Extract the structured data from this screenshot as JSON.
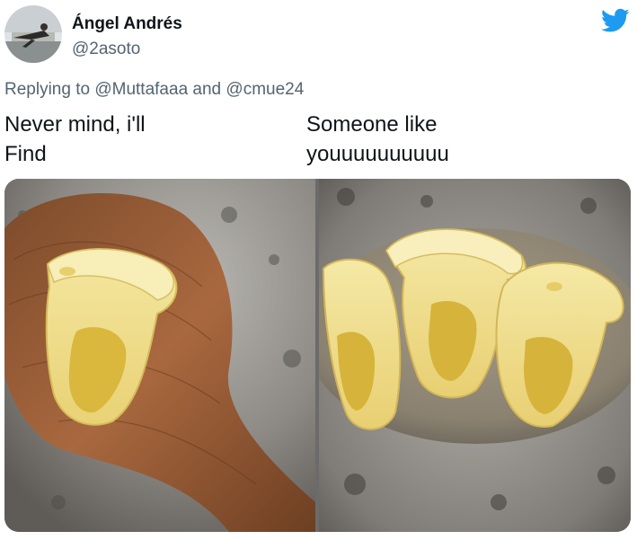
{
  "author": {
    "display_name": "Ángel Andrés",
    "handle": "@2asoto"
  },
  "reply": {
    "prefix": "Replying to",
    "mention_1": "@Muttafaaa",
    "conjunction": "and",
    "mention_2": "@cmue24"
  },
  "tweet": {
    "left_line_1": "Never mind, i'll",
    "left_line_2": "Find",
    "right_line_1": "Someone like",
    "right_line_2": "youuuuuuuuuu"
  },
  "icons": {
    "brand": "twitter-bird-icon",
    "brand_color": "#1d9bf0"
  }
}
